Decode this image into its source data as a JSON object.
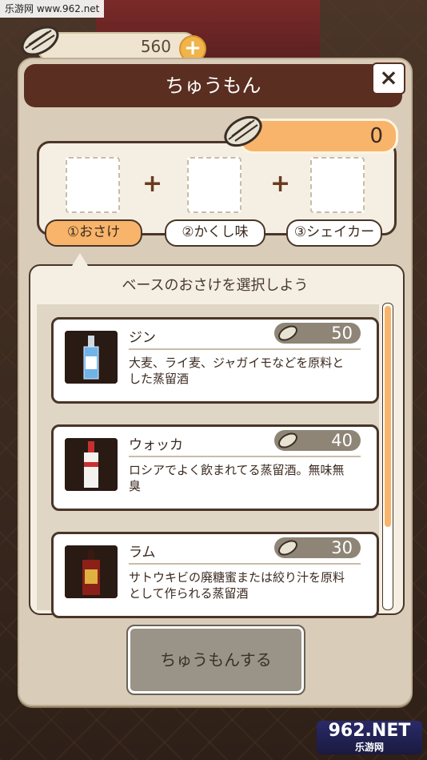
{
  "watermark": {
    "top_text": "乐游网 www.962.net",
    "logo_text": "962.NET",
    "logo_sub": "乐游网"
  },
  "currency": {
    "amount": "560",
    "plus_label": "+"
  },
  "dialog": {
    "title": "ちゅうもん",
    "close_label": "×"
  },
  "order": {
    "total": "0"
  },
  "slots": {
    "plus1": "+",
    "plus2": "+"
  },
  "steps": [
    {
      "label": "①おさけ",
      "active": true
    },
    {
      "label": "②かくし味",
      "active": false
    },
    {
      "label": "③シェイカー",
      "active": false
    }
  ],
  "selection": {
    "title": "ベースのおさけを選択しよう",
    "items": [
      {
        "name": "ジン",
        "price": "50",
        "description": "大麦、ライ麦、ジャガイモなどを原料とした蒸留酒",
        "icon": "gin-bottle-icon"
      },
      {
        "name": "ウォッカ",
        "price": "40",
        "description": "ロシアでよく飲まれてる蒸留酒。無味無臭",
        "icon": "vodka-bottle-icon"
      },
      {
        "name": "ラム",
        "price": "30",
        "description": "サトウキビの廃糖蜜または絞り汁を原料として作られる蒸留酒",
        "icon": "rum-bottle-icon"
      }
    ]
  },
  "actions": {
    "order_button": "ちゅうもんする"
  },
  "colors": {
    "accent": "#f7b46a",
    "title_bar": "#5a2e20",
    "panel": "#d9cdb9"
  }
}
